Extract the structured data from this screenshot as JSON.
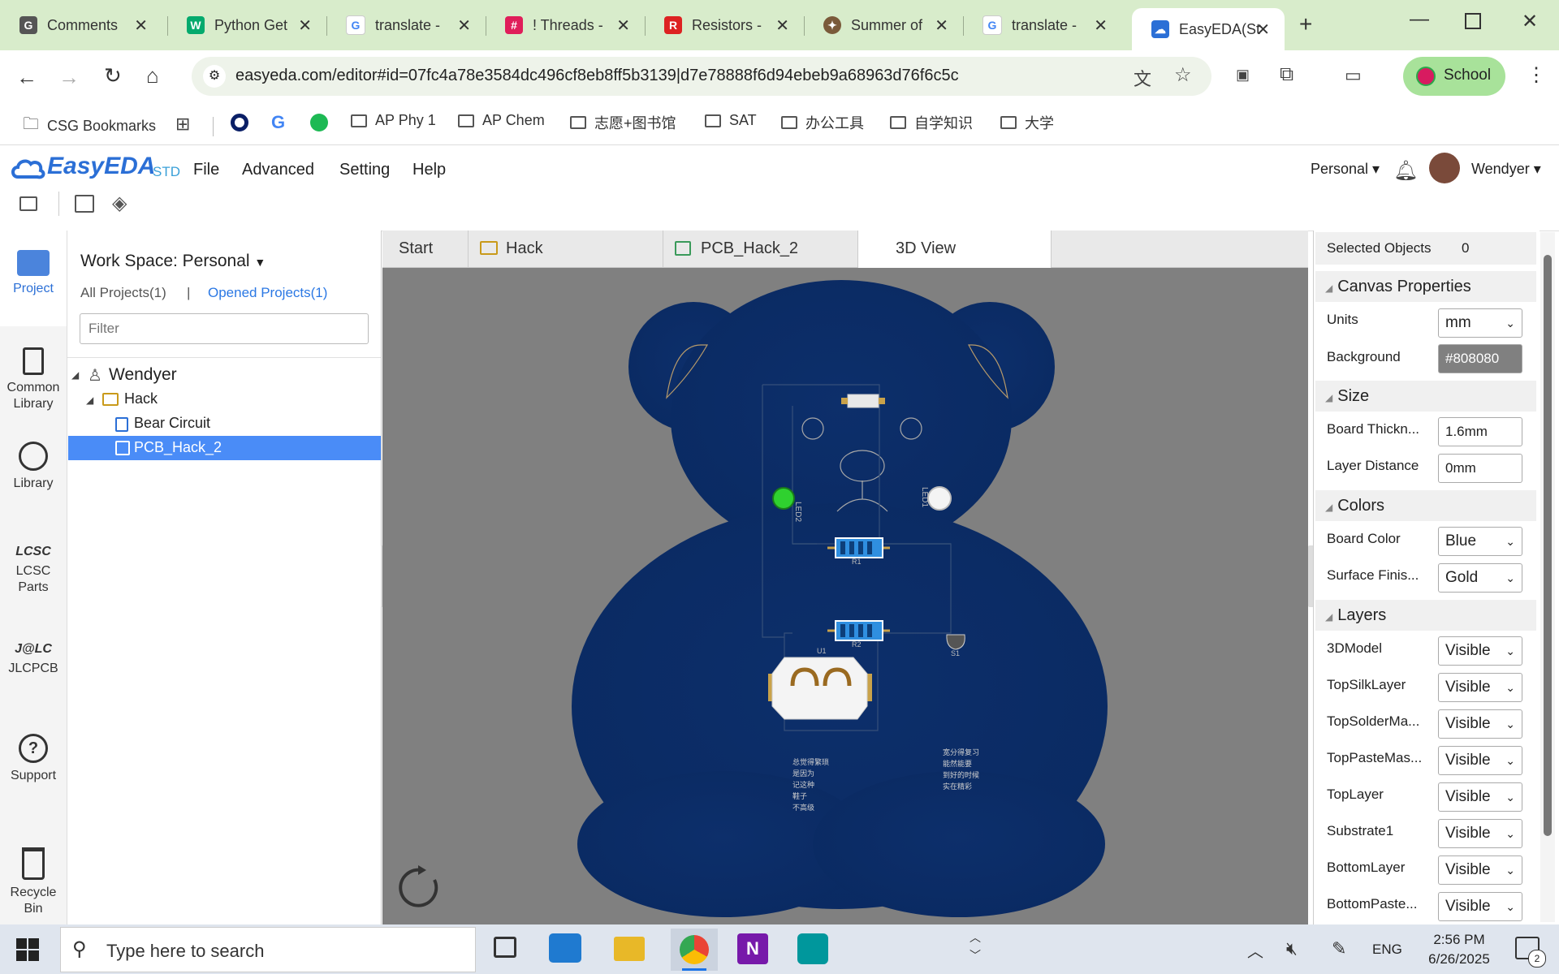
{
  "browser": {
    "tabs": [
      {
        "title": "Comments",
        "icon": "document-icon",
        "color": "#444"
      },
      {
        "title": "Python Get",
        "icon": "w3schools-icon",
        "color": "#04aa6d"
      },
      {
        "title": "translate -",
        "icon": "google-icon",
        "color": "#4285f4"
      },
      {
        "title": "! Threads -",
        "icon": "slack-icon",
        "color": "#e01e5a"
      },
      {
        "title": "Resistors -",
        "icon": "component-icon",
        "color": "#d22"
      },
      {
        "title": "Summer of",
        "icon": "compass-icon",
        "color": "#7a5a3a"
      },
      {
        "title": "translate -",
        "icon": "google-icon",
        "color": "#4285f4"
      },
      {
        "title": "EasyEDA(St",
        "icon": "easyeda-icon",
        "color": "#2b6fd6"
      }
    ],
    "url": "easyeda.com/editor#id=07fc4a78e3584dc496cf8eb8ff5b3139|d7e78888f6d94ebeb9a68963d76f6c5c",
    "profile": "School",
    "bookmarks": [
      "CSG Bookmarks",
      "AP Phy 1",
      "AP Chem",
      "志愿+图书馆",
      "SAT",
      "办公工具",
      "自学知识",
      "大学"
    ]
  },
  "app": {
    "logo": "EasyEDA",
    "logo_sub": "STD",
    "menu": [
      "File",
      "Advanced",
      "Setting",
      "Help"
    ],
    "workspace_btn": "Personal",
    "user": "Wendyer"
  },
  "rail": [
    "Project",
    "Common Library",
    "Library",
    "LCSC Parts",
    "JLCPCB",
    "Support",
    "Recycle Bin"
  ],
  "project": {
    "workspace": "Work Space: Personal",
    "all_projects": "All Projects(1)",
    "separator": "|",
    "opened_projects": "Opened Projects(1)",
    "filter_placeholder": "Filter",
    "tree": {
      "user": "Wendyer",
      "folder": "Hack",
      "items": [
        "Bear Circuit",
        "PCB_Hack_2"
      ]
    }
  },
  "editor_tabs": [
    "Start",
    "Hack",
    "PCB_Hack_2",
    "3D View"
  ],
  "board": {
    "labels": {
      "led2": "LED2",
      "led1": "LED1",
      "r1": "R1",
      "r2": "R2",
      "u1": "U1",
      "s1": "S1"
    },
    "text_left": [
      "总觉得繁琐",
      "是因为",
      "记这种",
      "鞋子",
      "不高级"
    ],
    "text_right": [
      "宽分得复习",
      "能然能要",
      "到好的时候",
      "实在精彩"
    ]
  },
  "properties": {
    "selected_label": "Selected Objects",
    "selected_count": "0",
    "canvas_title": "Canvas Properties",
    "units_label": "Units",
    "units_value": "mm",
    "background_label": "Background",
    "background_value": "#808080",
    "size_title": "Size",
    "thickness_label": "Board Thickn...",
    "thickness_value": "1.6mm",
    "layer_dist_label": "Layer Distance",
    "layer_dist_value": "0mm",
    "colors_title": "Colors",
    "board_color_label": "Board Color",
    "board_color_value": "Blue",
    "finish_label": "Surface Finis...",
    "finish_value": "Gold",
    "layers_title": "Layers",
    "layers": [
      {
        "name": "3DModel",
        "value": "Visible"
      },
      {
        "name": "TopSilkLayer",
        "value": "Visible"
      },
      {
        "name": "TopSolderMa...",
        "value": "Visible"
      },
      {
        "name": "TopPasteMas...",
        "value": "Visible"
      },
      {
        "name": "TopLayer",
        "value": "Visible"
      },
      {
        "name": "Substrate1",
        "value": "Visible"
      },
      {
        "name": "BottomLayer",
        "value": "Visible"
      },
      {
        "name": "BottomPaste...",
        "value": "Visible"
      }
    ]
  },
  "taskbar": {
    "search_placeholder": "Type here to search",
    "lang": "ENG",
    "time": "2:56 PM",
    "date": "6/26/2025",
    "notifications": "2"
  },
  "colors": {
    "accent": "#2b6fd6",
    "board": "#0d2f6b",
    "chrome": "#d8eccb",
    "selected": "#4a8cf7"
  }
}
